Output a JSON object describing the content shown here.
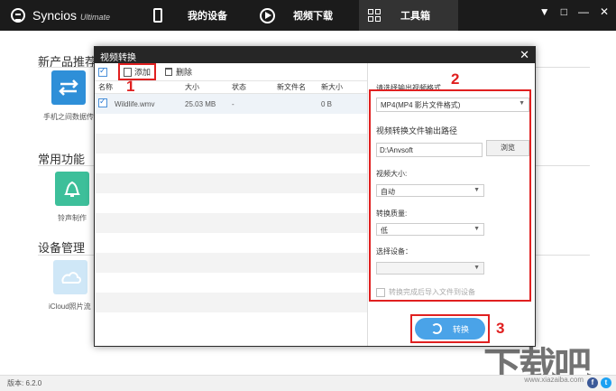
{
  "app": {
    "name": "Syncios",
    "edition": "Ultimate",
    "version": "版本: 6.2.0"
  },
  "nav": {
    "my_device": "我的设备",
    "video_download": "视频下载",
    "toolbox": "工具箱"
  },
  "window_buttons": [
    "▼",
    "□",
    "—",
    "✕"
  ],
  "sections": {
    "recommended": "新产品推荐",
    "recommended_item": "手机之间数据传输",
    "common": "常用功能",
    "ringtone": "铃声制作",
    "device_mgmt": "设备管理",
    "icloud": "iCloud照片流"
  },
  "dialog": {
    "title": "视频转换",
    "close": "✕",
    "toolbar": {
      "add": "添加",
      "delete": "删除"
    },
    "columns": [
      "名称",
      "大小",
      "状态",
      "新文件名",
      "新大小"
    ],
    "files": [
      {
        "name": "Wildlife.wmv",
        "size": "25.03 MB",
        "status": "-",
        "new_name": "",
        "new_size": "0 B"
      }
    ],
    "right": {
      "format_label": "请选择输出视频格式",
      "format_value": "MP4(MP4 影片文件格式)",
      "path_label": "视频转换文件输出路径",
      "path_value": "D:\\Anvsoft",
      "browse": "浏览",
      "size_label": "视频大小:",
      "size_value": "自动",
      "quality_label": "转换质量:",
      "quality_value": "低",
      "device_label": "选择设备：",
      "device_value": "",
      "import_after": "转换完成后导入文件到设备"
    },
    "convert": "转换"
  },
  "annotations": [
    "1",
    "2",
    "3"
  ],
  "watermark": {
    "text": "下载吧",
    "url": "www.xiazaiba.com"
  },
  "colors": {
    "title_bar": "#1b1b1b",
    "accent": "#4aa3e8",
    "highlight": "#e02020"
  }
}
